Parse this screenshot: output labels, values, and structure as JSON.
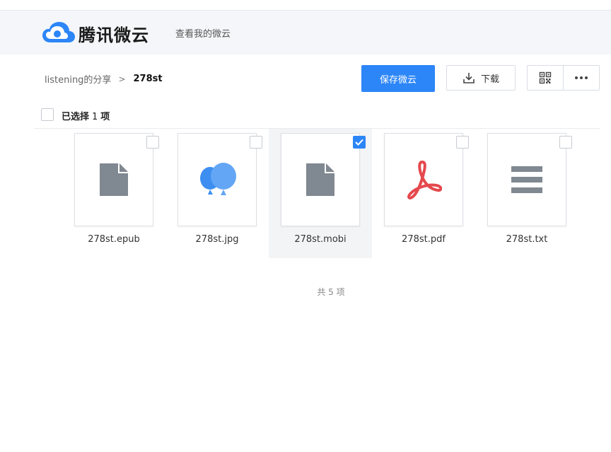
{
  "header": {
    "brand": "腾讯微云",
    "link": "查看我的微云"
  },
  "breadcrumb": {
    "parent": "listening的分享",
    "current": "278st"
  },
  "toolbar": {
    "save_label": "保存微云",
    "download_label": "下载"
  },
  "selection": {
    "prefix": "已选择",
    "count": "1",
    "suffix": "项"
  },
  "files": [
    {
      "name": "278st.epub",
      "icon": "document-icon",
      "selected": false
    },
    {
      "name": "278st.jpg",
      "icon": "balloons-icon",
      "selected": false
    },
    {
      "name": "278st.mobi",
      "icon": "document-icon",
      "selected": true
    },
    {
      "name": "278st.pdf",
      "icon": "pdf-icon",
      "selected": false
    },
    {
      "name": "278st.txt",
      "icon": "text-icon",
      "selected": false
    }
  ],
  "footer": {
    "total": "共 5 项"
  },
  "colors": {
    "accent": "#2c86f7",
    "icon_gray": "#808891",
    "pdf_red": "#e5484d"
  }
}
